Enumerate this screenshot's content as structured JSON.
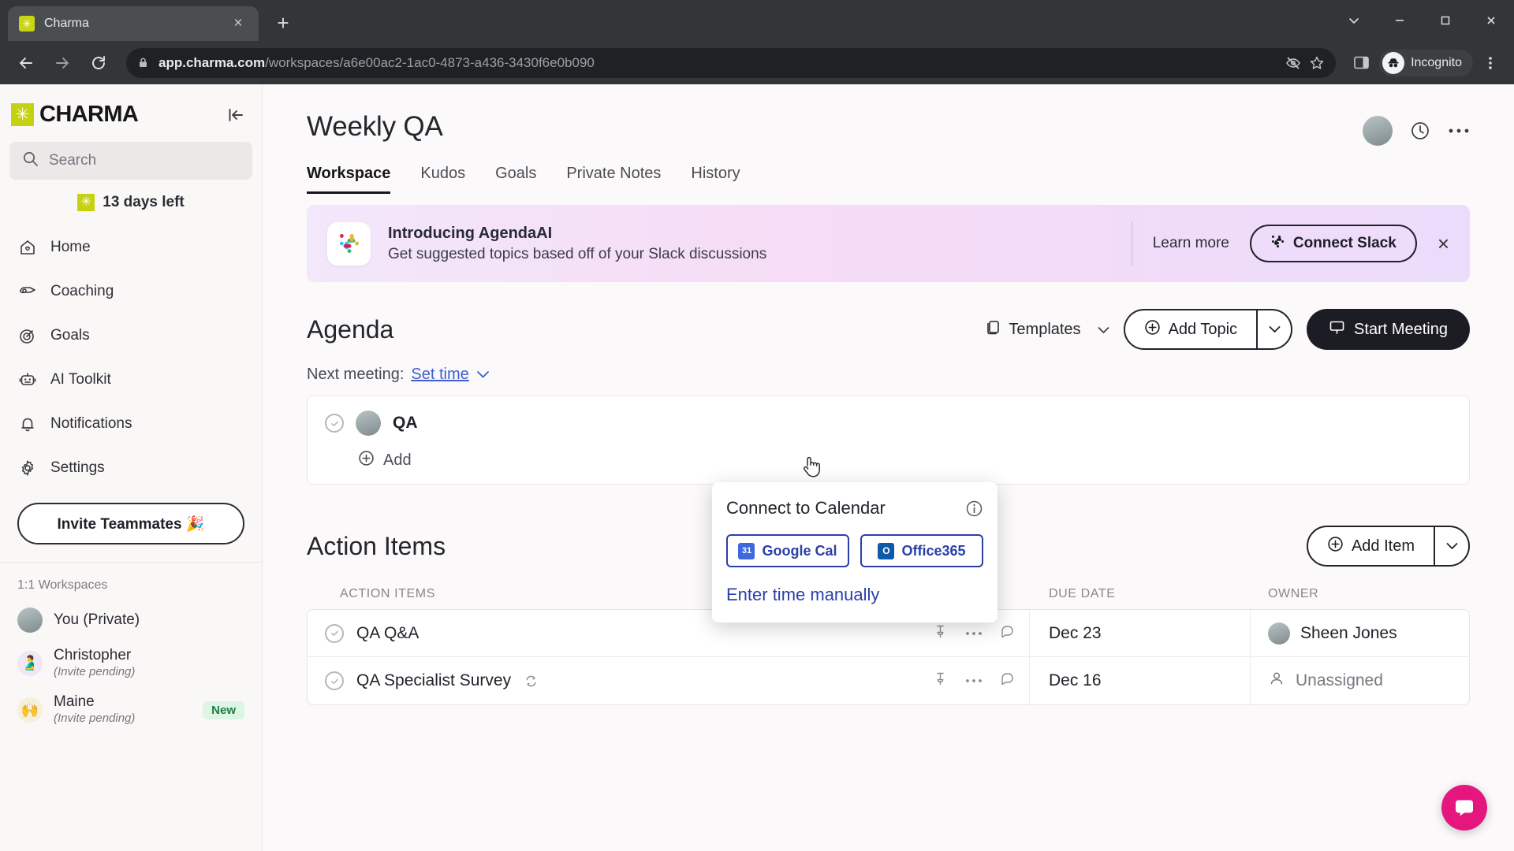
{
  "browser": {
    "tab": {
      "title": "Charma",
      "favicon": "charma-star-icon",
      "close": "×"
    },
    "new_tab_label": "+",
    "url_host": "app.charma.com",
    "url_path": "/workspaces/a6e00ac2-1ac0-4873-a436-3430f6e0b090",
    "profile_label": "Incognito",
    "icons": {
      "back": "back-arrow-icon",
      "forward": "forward-arrow-icon",
      "reload": "reload-icon",
      "lock": "lock-icon",
      "eye_off": "eye-off-icon",
      "bookmark": "star-icon",
      "side_panel": "side-panel-icon",
      "menu": "kebab-menu-icon"
    },
    "window": {
      "minimize": "−",
      "maximize": "▢",
      "close": "✕",
      "tab_search": "⌄"
    }
  },
  "sidebar": {
    "logo_text": "CHARMA",
    "collapse_label": "collapse-sidebar",
    "search": {
      "placeholder": "Search",
      "value": ""
    },
    "trial": "13 days left",
    "nav": [
      {
        "label": "Home",
        "icon": "home-icon"
      },
      {
        "label": "Coaching",
        "icon": "whistle-icon"
      },
      {
        "label": "Goals",
        "icon": "target-icon"
      },
      {
        "label": "AI Toolkit",
        "icon": "robot-icon"
      },
      {
        "label": "Notifications",
        "icon": "bell-icon"
      },
      {
        "label": "Settings",
        "icon": "gear-icon"
      }
    ],
    "invite_label": "Invite Teammates 🎉",
    "workspaces_title": "1:1 Workspaces",
    "workspaces": [
      {
        "name": "You (Private)",
        "sub": "",
        "badge": "",
        "avatar": "gray"
      },
      {
        "name": "Christopher",
        "sub": "(Invite pending)",
        "badge": "",
        "avatar": "pink"
      },
      {
        "name": "Maine",
        "sub": "(Invite pending)",
        "badge": "New",
        "avatar": "yellow"
      }
    ]
  },
  "header": {
    "title": "Weekly QA",
    "icons": {
      "avatar": "user-avatar",
      "history": "clock-icon",
      "more": "more-options-icon"
    }
  },
  "tabs": [
    {
      "label": "Workspace",
      "active": true
    },
    {
      "label": "Kudos",
      "active": false
    },
    {
      "label": "Goals",
      "active": false
    },
    {
      "label": "Private Notes",
      "active": false
    },
    {
      "label": "History",
      "active": false
    }
  ],
  "promo": {
    "icon": "slack-icon",
    "title": "Introducing AgendaAI",
    "subtitle": "Get suggested topics based off of your Slack discussions",
    "learn_more": "Learn more",
    "connect_label": "Connect Slack",
    "close": "×"
  },
  "agenda": {
    "title": "Agenda",
    "templates_label": "Templates",
    "add_topic_label": "Add Topic",
    "start_meeting_label": "Start Meeting",
    "next_meeting_label": "Next meeting:",
    "set_time_label": "Set time",
    "item_title": "QA",
    "add_inline_label": "Add"
  },
  "popover": {
    "title": "Connect to Calendar",
    "google_label": "Google Cal",
    "google_badge": "31",
    "office_label": "Office365",
    "office_badge": "O",
    "manual_label": "Enter time manually",
    "info_icon": "info-icon"
  },
  "action_items": {
    "title": "Action Items",
    "add_label": "Add Item",
    "columns": {
      "name": "ACTION ITEMS",
      "due": "DUE DATE",
      "owner": "OWNER"
    },
    "rows": [
      {
        "name": "QA Q&A",
        "recurring": false,
        "due": "Dec 23",
        "owner": "Sheen Jones",
        "unassigned": false
      },
      {
        "name": "QA Specialist Survey",
        "recurring": true,
        "due": "Dec 16",
        "owner": "Unassigned",
        "unassigned": true
      }
    ]
  },
  "support": {
    "icon": "intercom-chat-icon"
  },
  "colors": {
    "brand": "#c4d212",
    "accent_link": "#3f5fd0",
    "calendar_blue": "#2b3fa8",
    "intercom_pink": "#e5177f",
    "badge_new_bg": "#dcf5e4"
  }
}
